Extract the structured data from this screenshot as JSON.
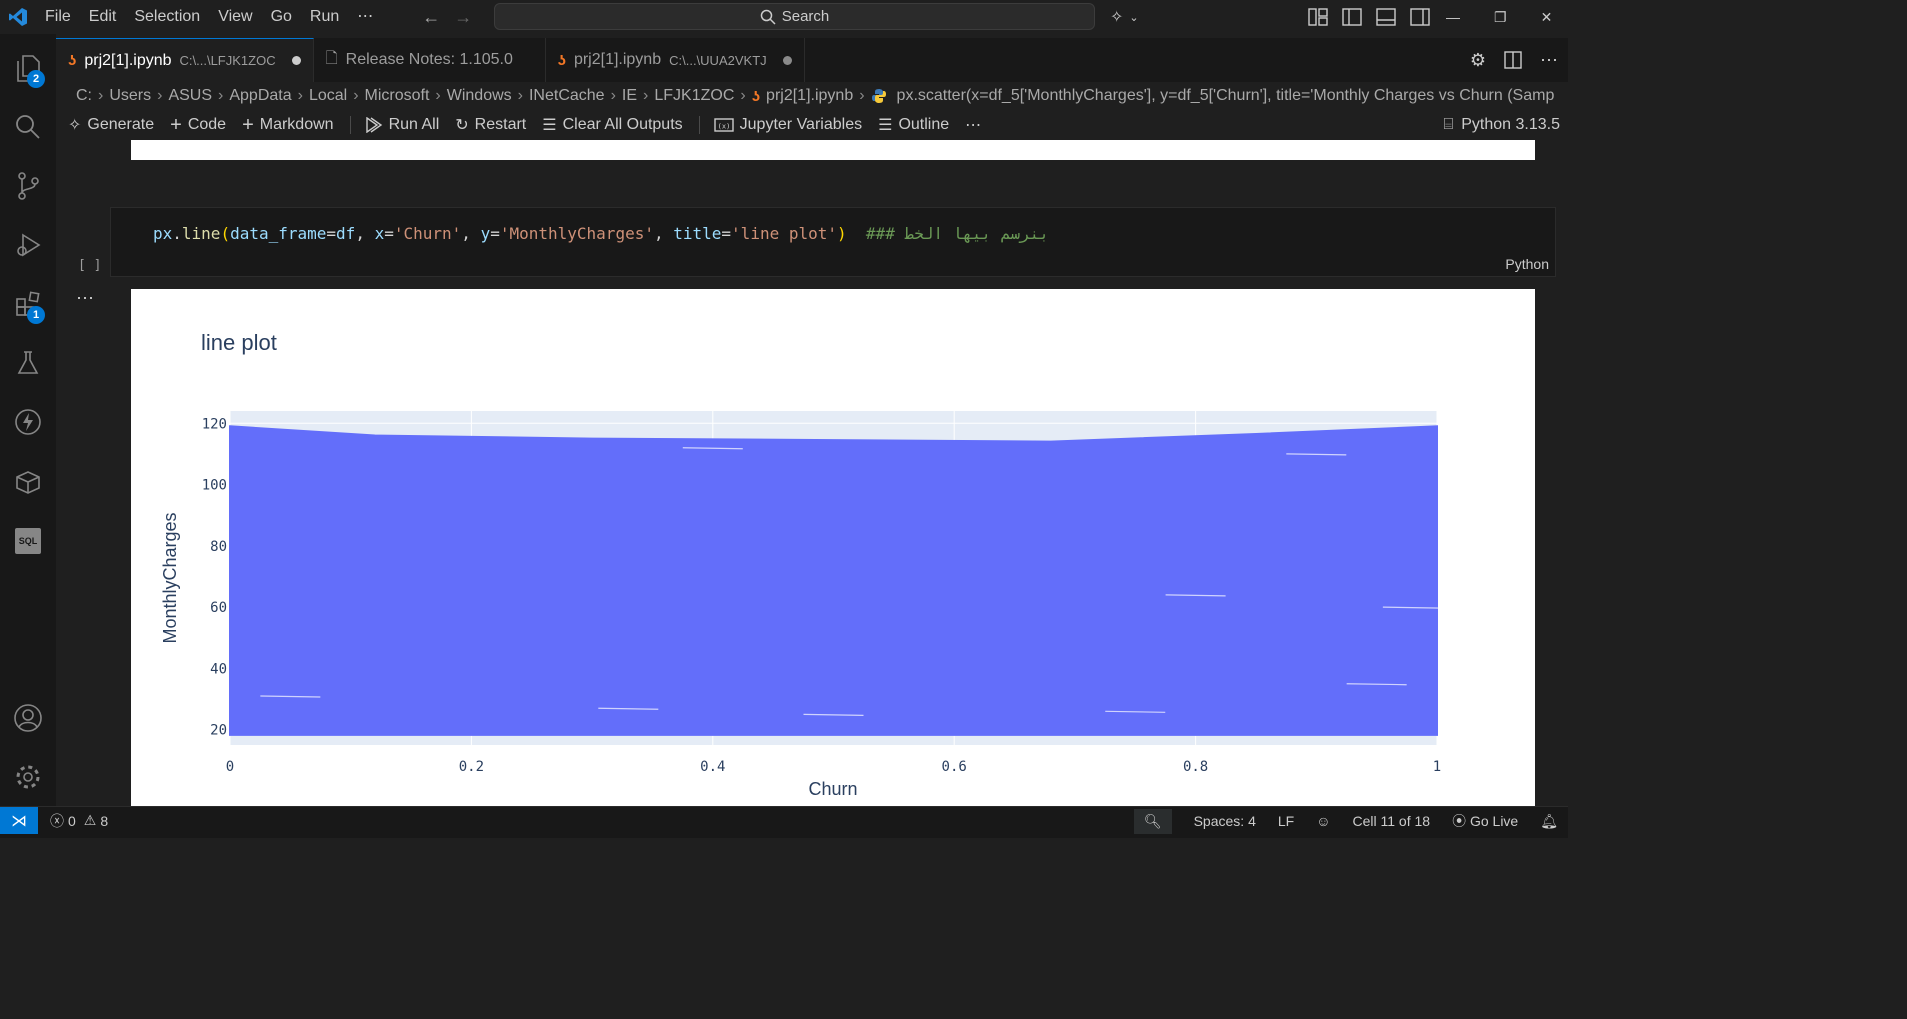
{
  "titlebar": {
    "menu": [
      "File",
      "Edit",
      "Selection",
      "View",
      "Go",
      "Run",
      "⋯"
    ],
    "search_label": "Search"
  },
  "activity_bar": {
    "explorer_badge": "2",
    "extensions_badge": "1",
    "sql_label": "SQL"
  },
  "tabs": [
    {
      "label": "prj2[1].ipynb",
      "path": "C:\\...\\LFJK1ZOC",
      "active": true,
      "dirty": true
    },
    {
      "label": "Release Notes: 1.105.0",
      "path": "",
      "active": false,
      "dirty": false
    },
    {
      "label": "prj2[1].ipynb",
      "path": "C:\\...\\UUA2VKTJ",
      "active": false,
      "dirty": true
    }
  ],
  "breadcrumb": {
    "parts": [
      "C:",
      "Users",
      "ASUS",
      "AppData",
      "Local",
      "Microsoft",
      "Windows",
      "INetCache",
      "IE",
      "LFJK1ZOC",
      "prj2[1].ipynb"
    ],
    "symbol": "px.scatter(x=df_5['MonthlyCharges'], y=df_5['Churn'], title='Monthly Charges vs Churn (Samp"
  },
  "toolbar": {
    "generate": "Generate",
    "code": "Code",
    "markdown": "Markdown",
    "run_all": "Run All",
    "restart": "Restart",
    "clear_outputs": "Clear All Outputs",
    "jupyter_variables": "Jupyter Variables",
    "outline": "Outline",
    "more": "⋯",
    "kernel": "Python 3.13.5"
  },
  "cell": {
    "code_tokens": {
      "obj": "px",
      "dot": ".",
      "fn": "line",
      "open": "(",
      "kw1": "data_frame",
      "eq1": "=",
      "val1": "df",
      "c1": ", ",
      "kw2": "x",
      "eq2": "=",
      "val2": "'Churn'",
      "c2": ", ",
      "kw3": "y",
      "eq3": "=",
      "val3": "'MonthlyCharges'",
      "c3": ", ",
      "kw4": "title",
      "eq4": "=",
      "val4": "'line plot'",
      "close": ")",
      "comment": "### بنرسم بيها الخط"
    },
    "exec_count": "[ ]",
    "language": "Python",
    "output_more": "⋯"
  },
  "chart_data": {
    "type": "line",
    "title": "line plot",
    "xlabel": "Churn",
    "ylabel": "MonthlyCharges",
    "xlim": [
      0,
      1
    ],
    "ylim": [
      15,
      124
    ],
    "x_ticks": [
      "0",
      "0.2",
      "0.4",
      "0.6",
      "0.8",
      "1"
    ],
    "y_ticks": [
      "20",
      "40",
      "60",
      "80",
      "100",
      "120"
    ],
    "series_color": "#636efa",
    "plot_bg": "#e5ecf6",
    "grid": true,
    "x": [
      0,
      0.12,
      0.3,
      0.5,
      0.68,
      0.85,
      1
    ],
    "upper": [
      119,
      116,
      115,
      114.5,
      114,
      116.5,
      119
    ],
    "lower": [
      18.3,
      18.3,
      18.3,
      18.3,
      18.3,
      18.3,
      18.3
    ]
  },
  "statusbar": {
    "errors": "0",
    "warnings": "8",
    "spaces": "Spaces: 4",
    "eol": "LF",
    "cell_pos": "Cell 11 of 18",
    "go_live": "Go Live"
  }
}
